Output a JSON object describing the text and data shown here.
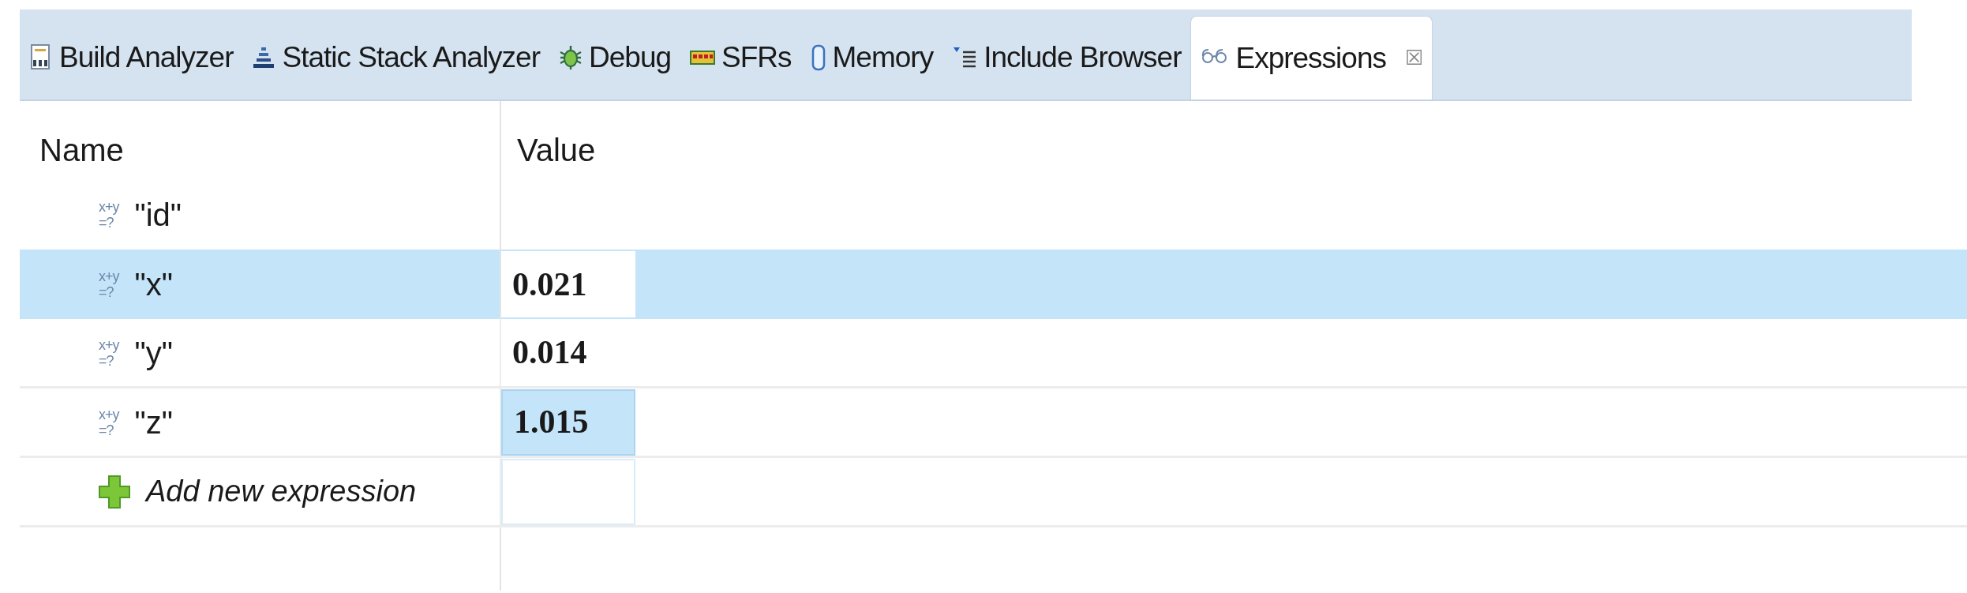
{
  "tabs": [
    {
      "label": "Build Analyzer",
      "selected": false,
      "closable": false
    },
    {
      "label": "Static Stack Analyzer",
      "selected": false,
      "closable": false
    },
    {
      "label": "Debug",
      "selected": false,
      "closable": false
    },
    {
      "label": "SFRs",
      "selected": false,
      "closable": false
    },
    {
      "label": "Memory",
      "selected": false,
      "closable": false
    },
    {
      "label": "Include Browser",
      "selected": false,
      "closable": false
    },
    {
      "label": "Expressions",
      "selected": true,
      "closable": true,
      "close_glyph": "☒"
    }
  ],
  "table": {
    "columns": [
      "Name",
      "Value"
    ],
    "rows": [
      {
        "kind": "expression",
        "icon_label": [
          "x+y",
          "=?"
        ],
        "name": "\"id\"",
        "selected": false
      },
      {
        "kind": "expression",
        "icon_label": [
          "x+y",
          "=?"
        ],
        "name": "\"x\"",
        "value": "0.021",
        "selected": true,
        "editing": true,
        "changed": false
      },
      {
        "kind": "expression",
        "icon_label": [
          "x+y",
          "=?"
        ],
        "name": "\"y\"",
        "value": "0.014",
        "selected": false,
        "editing": false,
        "changed": false
      },
      {
        "kind": "expression",
        "icon_label": [
          "x+y",
          "=?"
        ],
        "name": "\"z\"",
        "value": "1.015",
        "selected": false,
        "editing": false,
        "changed": true
      },
      {
        "kind": "add",
        "name": "Add new expression",
        "selected": false
      }
    ]
  }
}
